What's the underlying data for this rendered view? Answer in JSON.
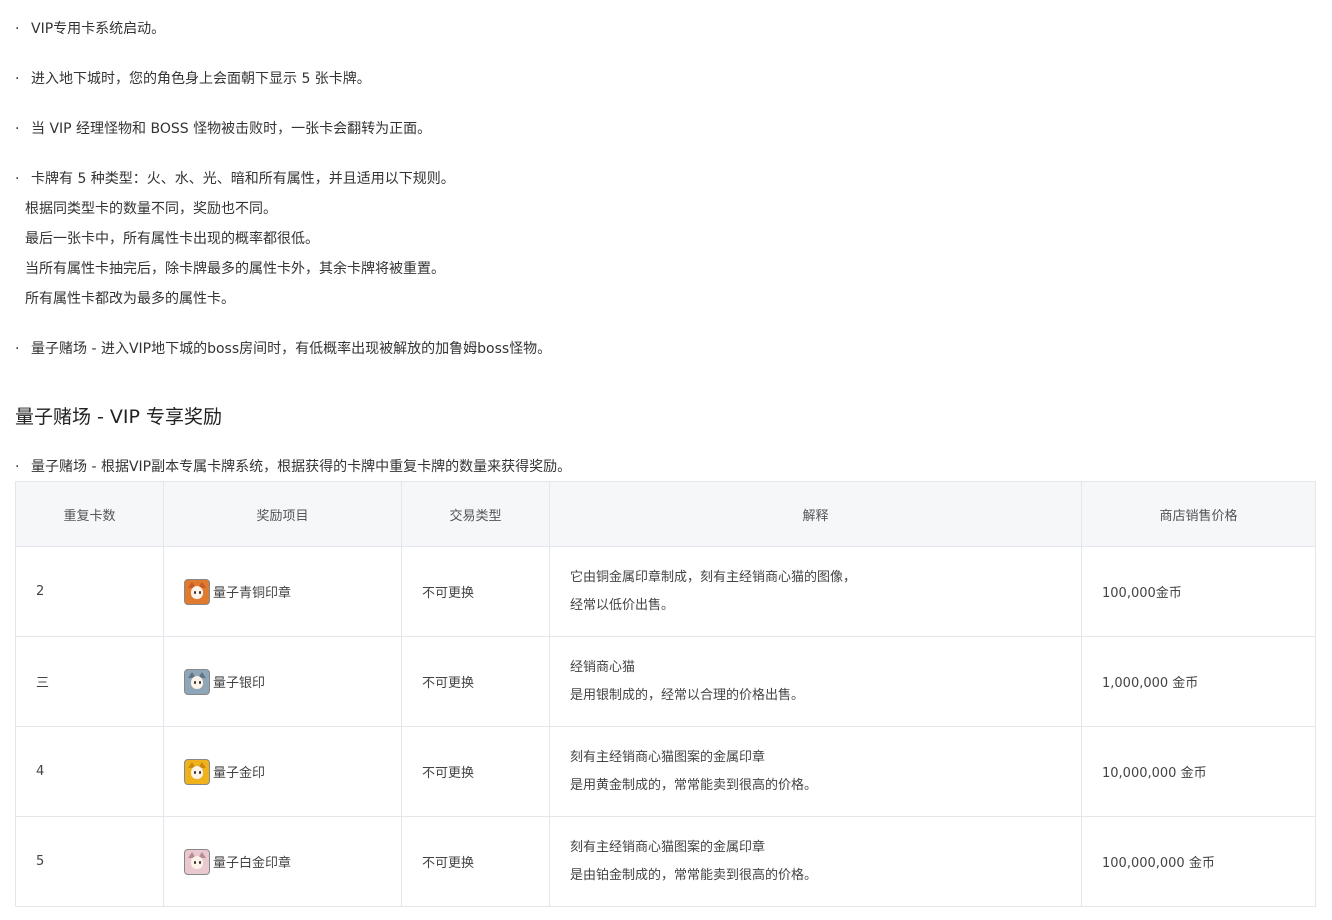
{
  "bullets": [
    {
      "dot": "·",
      "lines": [
        "VIP专用卡系统启动。"
      ]
    },
    {
      "dot": "·",
      "lines": [
        "进入地下城时，您的角色身上会面朝下显示 5 张卡牌。"
      ]
    },
    {
      "dot": "·",
      "lines": [
        "当 VIP 经理怪物和 BOSS 怪物被击败时，一张卡会翻转为正面。"
      ]
    },
    {
      "dot": "·",
      "lines": [
        "卡牌有 5 种类型：火、水、光、暗和所有属性，并且适用以下规则。"
      ],
      "sub": [
        "根据同类型卡的数量不同，奖励也不同。",
        "最后一张卡中，所有属性卡出现的概率都很低。",
        "当所有属性卡抽完后，除卡牌最多的属性卡外，其余卡牌将被重置。",
        "所有属性卡都改为最多的属性卡。"
      ]
    },
    {
      "dot": "·",
      "lines": [
        "量子赌场 - 进入VIP地下城的boss房间时，有低概率出现被解放的加鲁姆boss怪物。"
      ]
    }
  ],
  "section_title": "量子赌场 - VIP 专享奖励",
  "intro": {
    "dot": "·",
    "text": "量子赌场 - 根据VIP副本专属卡牌系统，根据获得的卡牌中重复卡牌的数量来获得奖励。"
  },
  "table": {
    "headers": [
      "重复卡数",
      "奖励项目",
      "交易类型",
      "解释",
      "商店销售价格"
    ],
    "rows": [
      {
        "count": "2",
        "item": "量子青铜印章",
        "icon": "bronze-seal-icon",
        "icon_color": "#e07a2e",
        "ear_color": "#c9582a",
        "trade": "不可更换",
        "desc": [
          "它由铜金属印章制成，刻有主经销商心猫的图像，",
          "经常以低价出售。"
        ],
        "price": "100,000金币"
      },
      {
        "count": "三",
        "item": "量子银印",
        "icon": "silver-seal-icon",
        "icon_color": "#8fa6b8",
        "ear_color": "#5f7484",
        "trade": "不可更换",
        "desc": [
          "经销商心猫",
          "是用银制成的，经常以合理的价格出售。"
        ],
        "price": "1,000,000 金币"
      },
      {
        "count": "4",
        "item": "量子金印",
        "icon": "gold-seal-icon",
        "icon_color": "#f0b21c",
        "ear_color": "#c98a0e",
        "trade": "不可更换",
        "desc": [
          "刻有主经销商心猫图案的金属印章",
          "是用黄金制成的，常常能卖到很高的价格。"
        ],
        "price": "10,000,000 金币"
      },
      {
        "count": "5",
        "item": "量子白金印章",
        "icon": "platinum-seal-icon",
        "icon_color": "#e9c9cf",
        "ear_color": "#b98a94",
        "trade": "不可更换",
        "desc": [
          "刻有主经销商心猫图案的金属印章",
          "是由铂金制成的，常常能卖到很高的价格。"
        ],
        "price": "100,000,000 金币"
      }
    ]
  }
}
